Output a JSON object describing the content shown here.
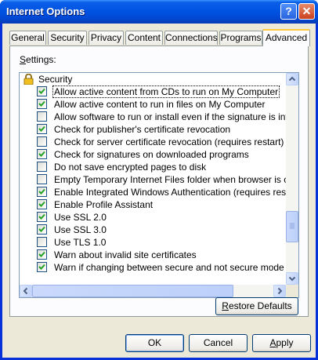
{
  "window": {
    "title": "Internet Options"
  },
  "titlebar_buttons": {
    "help": "?",
    "close": "✕"
  },
  "tabs": [
    {
      "label": "General"
    },
    {
      "label": "Security"
    },
    {
      "label": "Privacy"
    },
    {
      "label": "Content"
    },
    {
      "label": "Connections"
    },
    {
      "label": "Programs"
    },
    {
      "label": "Advanced",
      "active": true
    }
  ],
  "settings": {
    "label_u": "S",
    "label_rest": "ettings:",
    "section": "Security",
    "items": [
      {
        "label": "Allow active content from CDs to run on My Computer",
        "checked": true,
        "selected": true
      },
      {
        "label": "Allow active content to run in files on My Computer",
        "checked": true
      },
      {
        "label": "Allow software to run or install even if the signature is invalid",
        "checked": false
      },
      {
        "label": "Check for publisher's certificate revocation",
        "checked": true
      },
      {
        "label": "Check for server certificate revocation (requires restart)",
        "checked": false
      },
      {
        "label": "Check for signatures on downloaded programs",
        "checked": true
      },
      {
        "label": "Do not save encrypted pages to disk",
        "checked": false
      },
      {
        "label": "Empty Temporary Internet Files folder when browser is closed",
        "checked": false
      },
      {
        "label": "Enable Integrated Windows Authentication (requires restart)",
        "checked": true
      },
      {
        "label": "Enable Profile Assistant",
        "checked": true
      },
      {
        "label": "Use SSL 2.0",
        "checked": true
      },
      {
        "label": "Use SSL 3.0",
        "checked": true
      },
      {
        "label": "Use TLS 1.0",
        "checked": false
      },
      {
        "label": "Warn about invalid site certificates",
        "checked": true
      },
      {
        "label": "Warn if changing between secure and not secure mode",
        "checked": true
      }
    ]
  },
  "buttons": {
    "restore_u": "R",
    "restore_rest": "estore Defaults",
    "ok": "OK",
    "cancel": "Cancel",
    "apply_u": "A",
    "apply_rest": "pply"
  }
}
